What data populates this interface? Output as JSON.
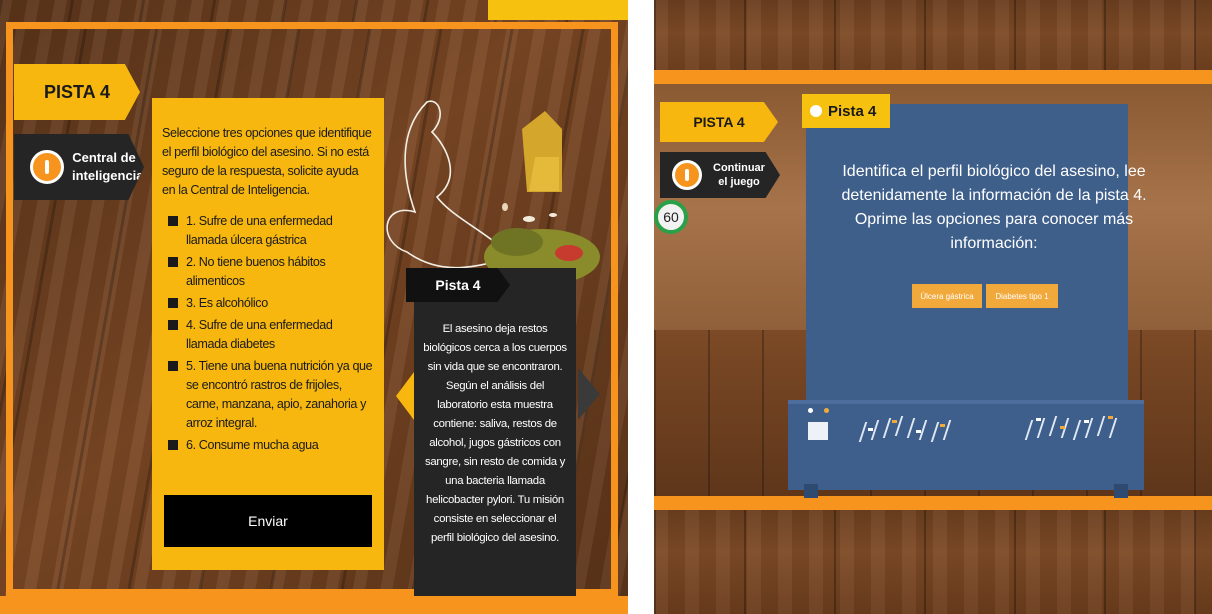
{
  "colors": {
    "orange": "#f7941d",
    "yellow": "#f7b70f",
    "dark": "#252525",
    "machine_blue": "#3f5f8b",
    "timer_green": "#2aa148"
  },
  "left_screen": {
    "pista_tab": "PISTA 4",
    "central_button": {
      "icon": "lightbulb-icon",
      "label": "Central de inteligencia"
    },
    "question": {
      "instructions": "Seleccione tres opciones que identifique el perfil biológico del asesino. Si no está seguro de la respuesta, solicite ayuda en la Central de Inteligencia.",
      "options": [
        "1. Sufre de una enfermedad llamada úlcera gástrica",
        "2. No tiene buenos hábitos alimenticos",
        "3. Es alcohólico",
        "4. Sufre de una enfermedad llamada diabetes",
        "5. Tiene una buena nutrición ya que se encontró rastros de frijoles, carne, manzana, apio, zanahoria y arroz integral.",
        "6. Consume mucha agua"
      ],
      "submit_label": "Enviar"
    },
    "clue_card": {
      "title": "Pista 4",
      "text": "El asesino deja restos biológicos cerca a los cuerpos sin vida que se encontraron. Según el análisis del laboratorio esta muestra contiene: saliva, restos de alcohol, jugos gástricos con sangre, sin resto de comida y una bacteria llamada helicobacter pylori. Tu misión consiste en seleccionar el perfil biológico del asesino."
    }
  },
  "right_screen": {
    "pista_tab": "PISTA 4",
    "continue_button": {
      "icon": "lightbulb-icon",
      "label": "Continuar el juego"
    },
    "timer": "60",
    "machine_label": "Pista 4",
    "intro_text": "Identifica el perfil biológico del asesino, lee detenidamente la información de la pista 4. Oprime las opciones para conocer más información:",
    "option_buttons": [
      "Úlcera gástrica",
      "Diabetes tipo 1"
    ]
  }
}
